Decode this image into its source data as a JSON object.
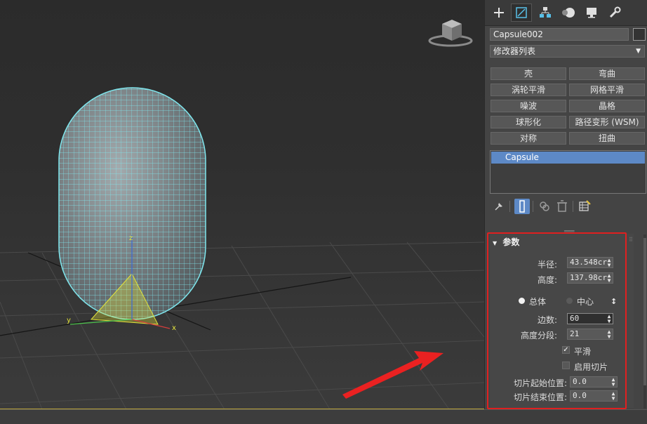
{
  "object_name": "Capsule002",
  "modifier_list": {
    "label": "修改器列表"
  },
  "modifier_buttons": [
    "壳",
    "弯曲",
    "涡轮平滑",
    "网格平滑",
    "噪波",
    "晶格",
    "球形化",
    "路径变形 (WSM)",
    "对称",
    "扭曲"
  ],
  "stack": {
    "selected": "Capsule"
  },
  "params": {
    "title": "参数",
    "radius_label": "半径:",
    "radius_value": "43.548cr",
    "height_label": "高度:",
    "height_value": "137.98cr",
    "overall_label": "总体",
    "center_label": "中心",
    "sides_label": "边数:",
    "sides_value": "60",
    "height_segs_label": "高度分段:",
    "height_segs_value": "21",
    "smooth_label": "平滑",
    "slice_label": "启用切片",
    "slice_from_label": "切片起始位置:",
    "slice_from_value": "0.0",
    "slice_to_label": "切片结束位置:",
    "slice_to_value": "0.0"
  },
  "axes": {
    "x": "x",
    "y": "y",
    "z": "z"
  },
  "colors": {
    "wire": "#7fe7ee",
    "accent": "#5d89c6",
    "highlight": "#e02020",
    "gizmo": "#e3e33a"
  },
  "icons": [
    "create-plus-icon",
    "modify-icon",
    "hierarchy-icon",
    "motion-icon",
    "display-icon",
    "utilities-wrench-icon",
    "pin-icon",
    "show-end-result-icon",
    "make-unique-icon",
    "remove-modifier-icon",
    "configure-sets-icon",
    "viewcube-icon",
    "arrow-annotation-icon"
  ]
}
